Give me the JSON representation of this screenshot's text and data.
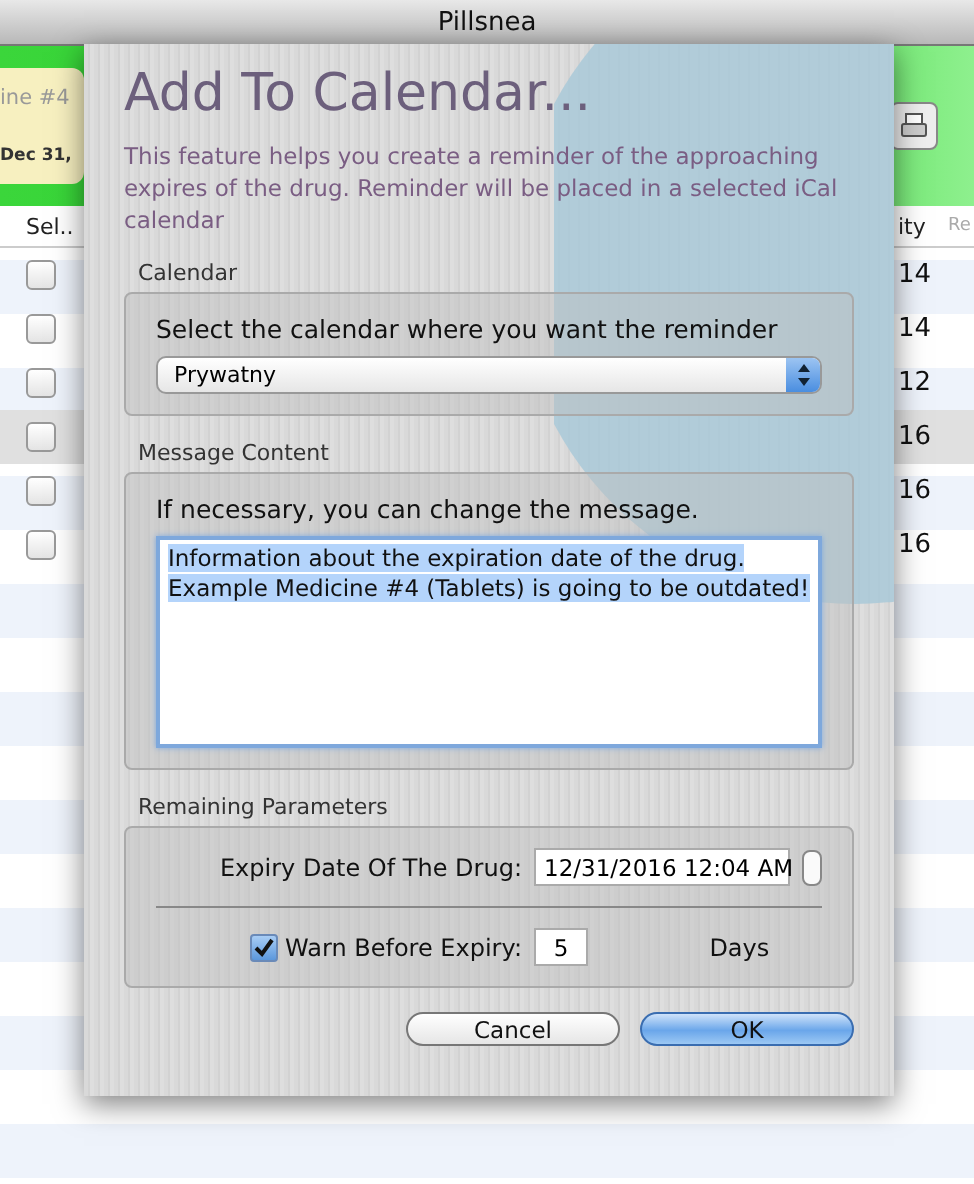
{
  "window": {
    "title": "Pillsnea"
  },
  "toolbar": {
    "card_lines": [
      "ine #4",
      "Dec 31,"
    ]
  },
  "table": {
    "columns": [
      "Sel..",
      "ity",
      "Re"
    ],
    "rows": [
      {
        "checked": false,
        "selected": false,
        "cell": "14"
      },
      {
        "checked": false,
        "selected": false,
        "cell": "14"
      },
      {
        "checked": false,
        "selected": false,
        "cell": "12"
      },
      {
        "checked": false,
        "selected": true,
        "cell": "16"
      },
      {
        "checked": false,
        "selected": false,
        "cell": "16"
      },
      {
        "checked": false,
        "selected": false,
        "cell": "16"
      }
    ]
  },
  "sheet": {
    "title": "Add To Calendar...",
    "description": "This feature helps you create a reminder of the approaching expires of the drug. Reminder will be placed in a selected iCal calendar",
    "calendar": {
      "heading": "Calendar",
      "prompt": "Select the calendar where you want the reminder",
      "value": "Prywatny"
    },
    "message": {
      "heading": "Message Content",
      "prompt": "If necessary, you can change the message.",
      "value": "Information about the expiration date of the drug. Example Medicine #4 (Tablets) is going to be outdated!"
    },
    "parameters": {
      "heading": "Remaining Parameters",
      "expiry_label": "Expiry Date Of The Drug:",
      "expiry_value": "12/31/2016 12:04 AM",
      "warn_label": "Warn Before Expiry:",
      "warn_checked": true,
      "warn_days": "5",
      "days_unit": "Days"
    },
    "buttons": [
      {
        "label": "Cancel",
        "default": false
      },
      {
        "label": "OK",
        "default": true
      }
    ]
  }
}
